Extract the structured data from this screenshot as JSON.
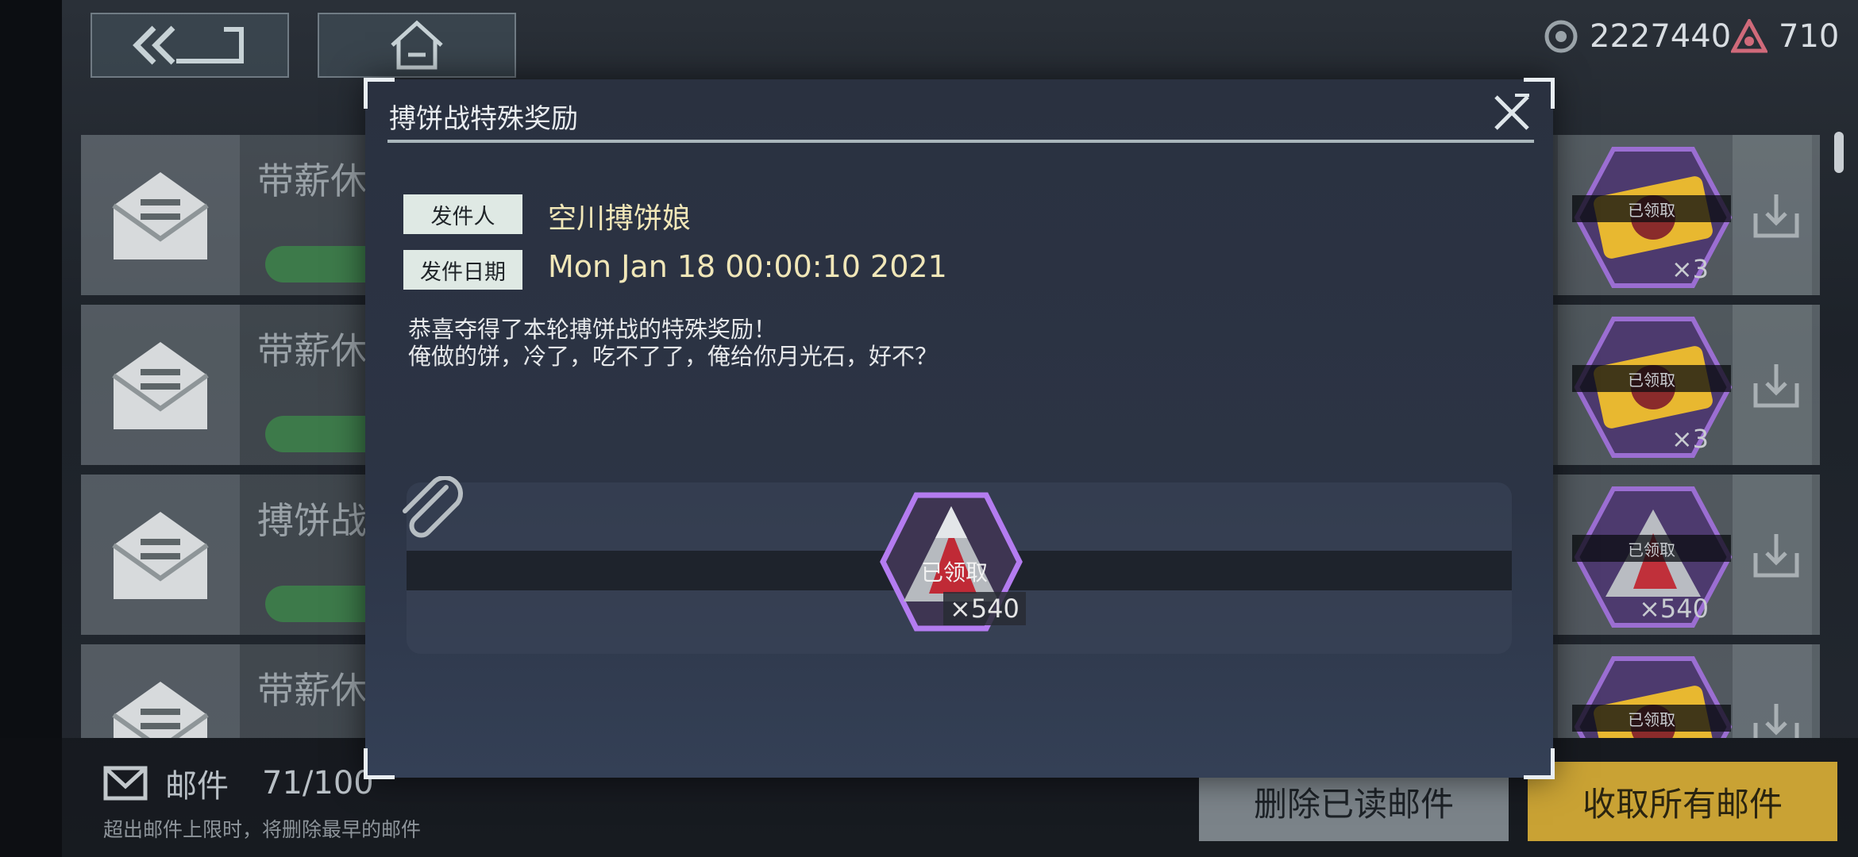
{
  "currency": {
    "coins": "2227440",
    "gems": "710"
  },
  "mail_list": [
    {
      "subject": "带薪休",
      "quantity": "×3",
      "claimed": "已领取"
    },
    {
      "subject": "带薪休",
      "quantity": "×3",
      "claimed": "已领取"
    },
    {
      "subject": "搏饼战",
      "quantity": "×540",
      "claimed": "已领取"
    },
    {
      "subject": "带薪休",
      "quantity": "",
      "claimed": "已领取"
    }
  ],
  "footer": {
    "mail_label": "邮件",
    "mail_count": "71/100",
    "limit_note": "超出邮件上限时，将删除最早的邮件",
    "delete_read": "删除已读邮件",
    "collect_all": "收取所有邮件"
  },
  "modal": {
    "title": "搏饼战特殊奖励",
    "sender_label": "发件人",
    "sender": "空川搏饼娘",
    "date_label": "发件日期",
    "date": "Mon Jan 18 00:00:10 2021",
    "body_line1": "恭喜夺得了本轮搏饼战的特殊奖励！",
    "body_line2": "俺做的饼，冷了，吃不了了，俺给你月光石，好不？",
    "attachment": {
      "claimed": "已领取",
      "quantity": "×540"
    }
  },
  "colors": {
    "accent_gold": "#c9a234",
    "date_text": "#f1e7b8",
    "tag_bg": "#dfe9e4"
  },
  "icons": [
    "back-icon",
    "home-icon",
    "coin-icon",
    "gem-icon",
    "envelope-icon",
    "download-icon",
    "close-icon",
    "paperclip-icon",
    "moonstone-icon"
  ]
}
